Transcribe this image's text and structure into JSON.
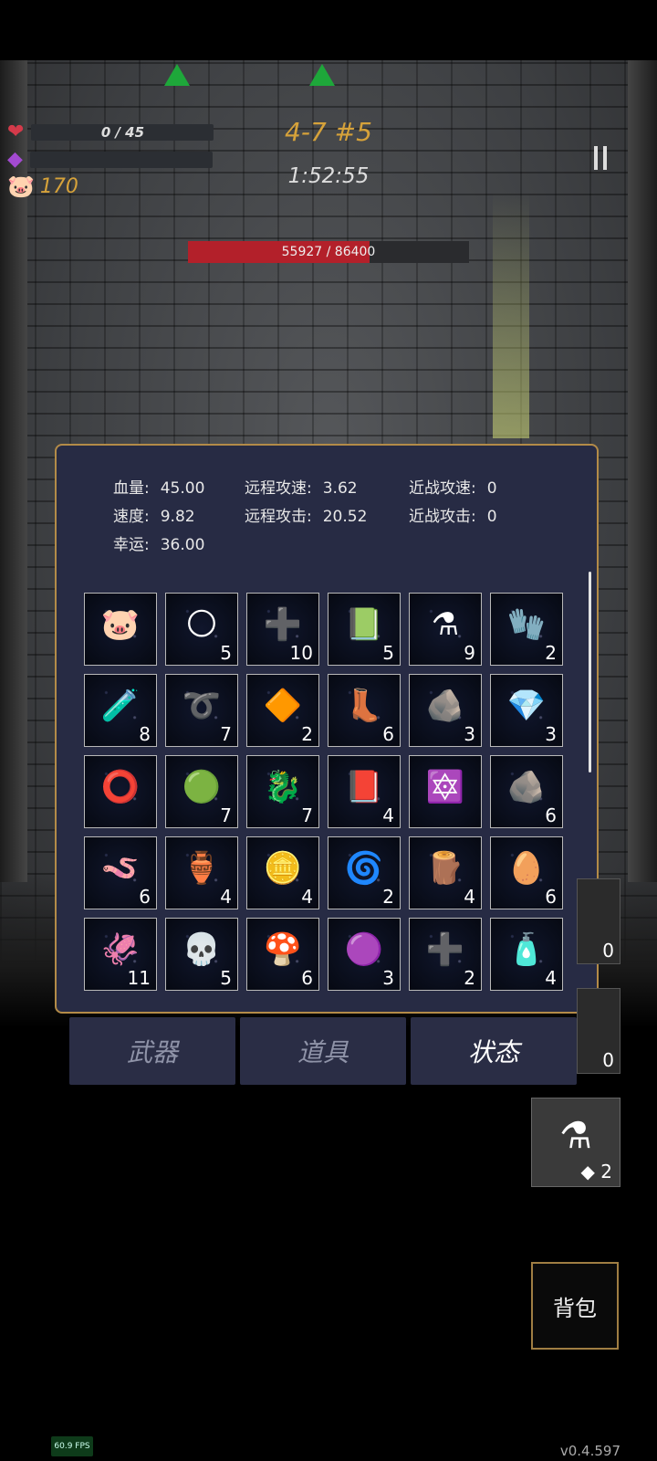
{
  "hud": {
    "hp_text": "0 / 45",
    "coins": "170",
    "stage": "4-7 #5",
    "timer": "1:52:55",
    "boss_hp_text": "55927 / 86400",
    "boss_hp_fraction": 0.647,
    "heart_icon": "heart-icon",
    "mana_icon": "purple-gem-icon",
    "coin_icon": "pig-icon"
  },
  "stats": {
    "hp_label": "血量:",
    "hp_value": "45.00",
    "speed_label": "速度:",
    "speed_value": "9.82",
    "luck_label": "幸运:",
    "luck_value": "36.00",
    "ranged_speed_label": "远程攻速:",
    "ranged_speed_value": "3.62",
    "ranged_atk_label": "远程攻击:",
    "ranged_atk_value": "20.52",
    "melee_speed_label": "近战攻速:",
    "melee_speed_value": "0",
    "melee_atk_label": "近战攻击:",
    "melee_atk_value": "0"
  },
  "items": [
    {
      "icon": "🐷",
      "count": ""
    },
    {
      "icon": "🌕",
      "count": "5"
    },
    {
      "icon": "➕",
      "count": "10"
    },
    {
      "icon": "📗",
      "count": "5"
    },
    {
      "icon": "⚗",
      "count": "9"
    },
    {
      "icon": "🧤",
      "count": "2"
    },
    {
      "icon": "🧪",
      "count": "8"
    },
    {
      "icon": "➰",
      "count": "7"
    },
    {
      "icon": "🔶",
      "count": "2"
    },
    {
      "icon": "👢",
      "count": "6"
    },
    {
      "icon": "🪨",
      "count": "3"
    },
    {
      "icon": "💎",
      "count": "3"
    },
    {
      "icon": "⭕",
      "count": ""
    },
    {
      "icon": "🟢",
      "count": "7"
    },
    {
      "icon": "🐉",
      "count": "7"
    },
    {
      "icon": "📕",
      "count": "4"
    },
    {
      "icon": "🔯",
      "count": ""
    },
    {
      "icon": "🪨",
      "count": "6"
    },
    {
      "icon": "🪱",
      "count": "6"
    },
    {
      "icon": "🏺",
      "count": "4"
    },
    {
      "icon": "🪙",
      "count": "4"
    },
    {
      "icon": "🌀",
      "count": "2"
    },
    {
      "icon": "🪵",
      "count": "4"
    },
    {
      "icon": "🥚",
      "count": "6"
    },
    {
      "icon": "🦑",
      "count": "11"
    },
    {
      "icon": "💀",
      "count": "5"
    },
    {
      "icon": "🍄",
      "count": "6"
    },
    {
      "icon": "🟣",
      "count": "3"
    },
    {
      "icon": "➕",
      "count": "2"
    },
    {
      "icon": "🧴",
      "count": "4"
    }
  ],
  "tabs": [
    {
      "label": "武器"
    },
    {
      "label": "道具"
    },
    {
      "label": "状态"
    }
  ],
  "side_slots": [
    {
      "count": "0"
    },
    {
      "count": "0"
    }
  ],
  "potion": {
    "icon": "potion-icon",
    "count": "◆ 2"
  },
  "bag_label": "背包",
  "fps": "60.9 FPS",
  "version": "v0.4.597"
}
